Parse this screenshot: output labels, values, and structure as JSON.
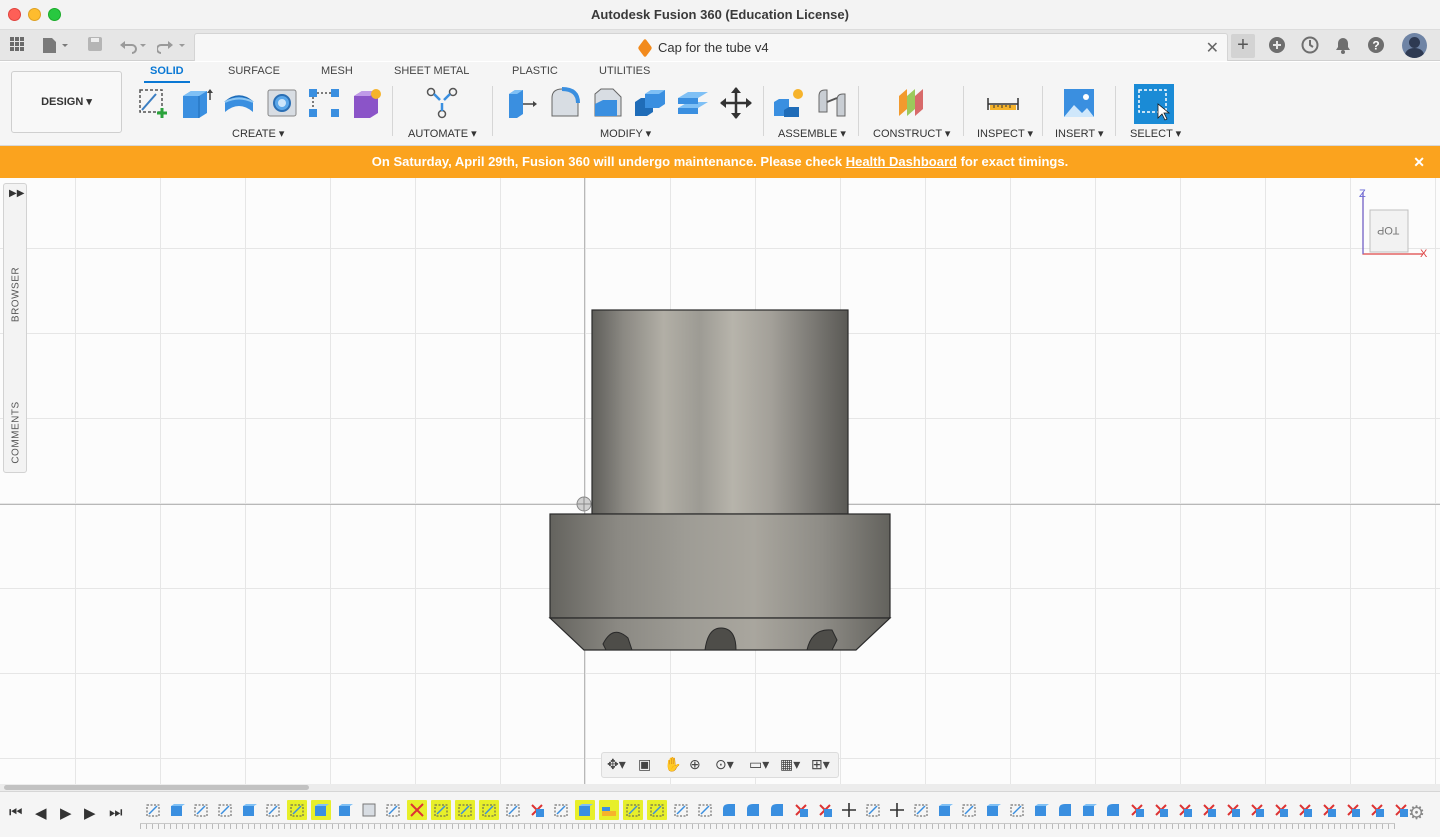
{
  "window": {
    "title": "Autodesk Fusion 360 (Education License)"
  },
  "tabbar": {
    "document_name": "Cap for the tube v4",
    "icons": [
      "grid-icon",
      "file-icon",
      "save-icon",
      "undo-icon",
      "redo-icon",
      "plus-icon",
      "extensions-icon",
      "job-status-icon",
      "notifications-icon",
      "help-icon",
      "avatar"
    ]
  },
  "ribbon": {
    "workspace": "DESIGN ▾",
    "tabs": [
      "SOLID",
      "SURFACE",
      "MESH",
      "SHEET METAL",
      "PLASTIC",
      "UTILITIES"
    ],
    "active_tab": "SOLID",
    "groups": {
      "create": "CREATE ▾",
      "automate": "AUTOMATE ▾",
      "modify": "MODIFY ▾",
      "assemble": "ASSEMBLE ▾",
      "construct": "CONSTRUCT ▾",
      "inspect": "INSPECT ▾",
      "insert": "INSERT ▾",
      "select": "SELECT ▾"
    }
  },
  "banner": {
    "text_before": "On Saturday, April 29th, Fusion 360 will undergo maintenance. Please check ",
    "link": "Health Dashboard",
    "text_after": " for exact timings.",
    "close": "✕",
    "color": "#fba31e"
  },
  "side_panel": {
    "browser": "BROWSER",
    "comments": "COMMENTS",
    "expand": "▶▶"
  },
  "viewcube": {
    "face": "TOP",
    "axis_z": "Z",
    "axis_x": "X"
  },
  "colors": {
    "accent": "#0a78d4",
    "highlight": "#e7ef2a"
  }
}
